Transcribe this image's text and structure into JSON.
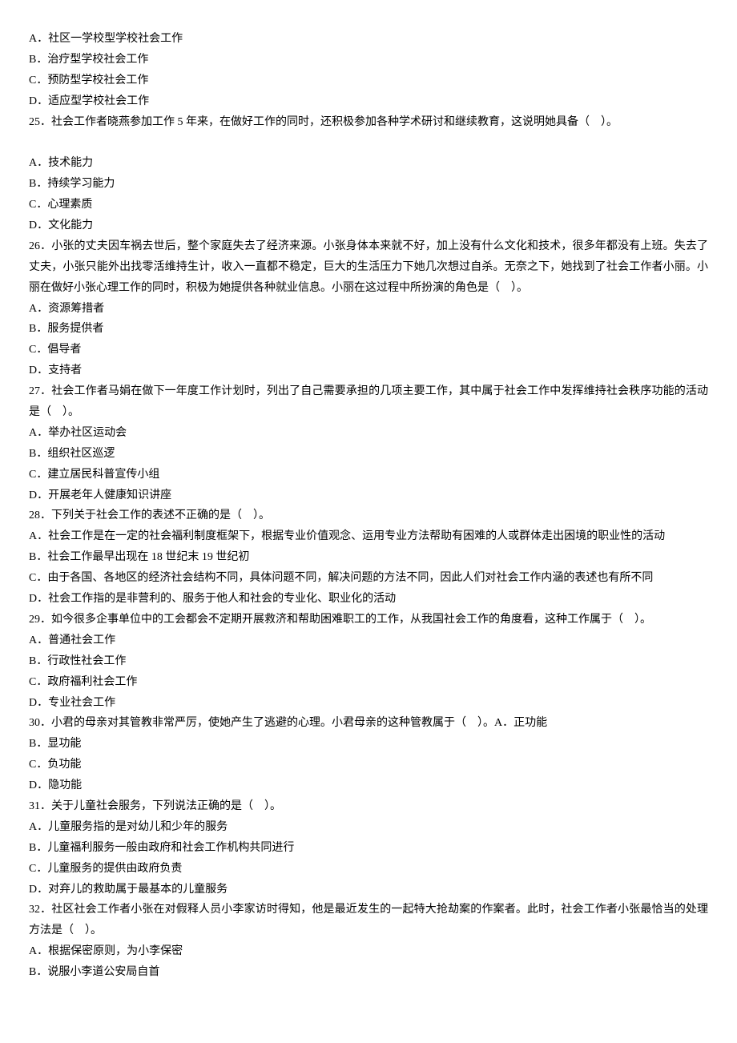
{
  "q24_options": {
    "a": "A．社区一学校型学校社会工作",
    "b": "B．治疗型学校社会工作",
    "c": "C．预防型学校社会工作",
    "d": "D．适应型学校社会工作"
  },
  "q25": {
    "stem": "25．社会工作者晓燕参加工作 5 年来，在做好工作的同时，还积极参加各种学术研讨和继续教育，这说明她具备（　）。",
    "a": "A．技术能力",
    "b": "B．持续学习能力",
    "c": "C．心理素质",
    "d": "D．文化能力"
  },
  "q26": {
    "stem": "26．小张的丈夫因车祸去世后，整个家庭失去了经济来源。小张身体本来就不好，加上没有什么文化和技术，很多年都没有上班。失去了丈夫，小张只能外出找零活维持生计，收入一直都不稳定，巨大的生活压力下她几次想过自杀。无奈之下，她找到了社会工作者小丽。小丽在做好小张心理工作的同时，积极为她提供各种就业信息。小丽在这过程中所扮演的角色是（　）。",
    "a": "A．资源筹措者",
    "b": "B．服务提供者",
    "c": "C．倡导者",
    "d": "D．支持者"
  },
  "q27": {
    "stem": "27．社会工作者马娟在做下一年度工作计划时，列出了自己需要承担的几项主要工作，其中属于社会工作中发挥维持社会秩序功能的活动是（　）。",
    "a": "A．举办社区运动会",
    "b": "B．组织社区巡逻",
    "c": "C．建立居民科普宣传小组",
    "d": "D．开展老年人健康知识讲座"
  },
  "q28": {
    "stem": "28．下列关于社会工作的表述不正确的是（　）。",
    "a": "A．社会工作是在一定的社会福利制度框架下，根据专业价值观念、运用专业方法帮助有困难的人或群体走出困境的职业性的活动",
    "b": "B．社会工作最早出现在 18 世纪末 19 世纪初",
    "c": "C．由于各国、各地区的经济社会结构不同，具体问题不同，解决问题的方法不同，因此人们对社会工作内涵的表述也有所不同",
    "d": "D．社会工作指的是非营利的、服务于他人和社会的专业化、职业化的活动"
  },
  "q29": {
    "stem": "29．如今很多企事单位中的工会都会不定期开展救济和帮助困难职工的工作，从我国社会工作的角度看，这种工作属于（　）。",
    "a": "A．普通社会工作",
    "b": "B．行政性社会工作",
    "c": "C．政府福利社会工作",
    "d": "D．专业社会工作"
  },
  "q30": {
    "stem": "30．小君的母亲对其管教非常严厉，使她产生了逃避的心理。小君母亲的这种管教属于（　）。A．正功能",
    "b": "B．显功能",
    "c": "C．负功能",
    "d": "D．隐功能"
  },
  "q31": {
    "stem": "31．关于儿童社会服务，下列说法正确的是（　）。",
    "a": "A．儿童服务指的是对幼儿和少年的服务",
    "b": "B．儿童福利服务一般由政府和社会工作机构共同进行",
    "c": "C．儿童服务的提供由政府负责",
    "d": "D．对弃儿的救助属于最基本的儿童服务"
  },
  "q32": {
    "stem": "32．社区社会工作者小张在对假释人员小李家访时得知，他是最近发生的一起特大抢劫案的作案者。此时，社会工作者小张最恰当的处理方法是（　）。",
    "a": "A．根据保密原则，为小李保密",
    "b": "B．说服小李道公安局自首"
  }
}
